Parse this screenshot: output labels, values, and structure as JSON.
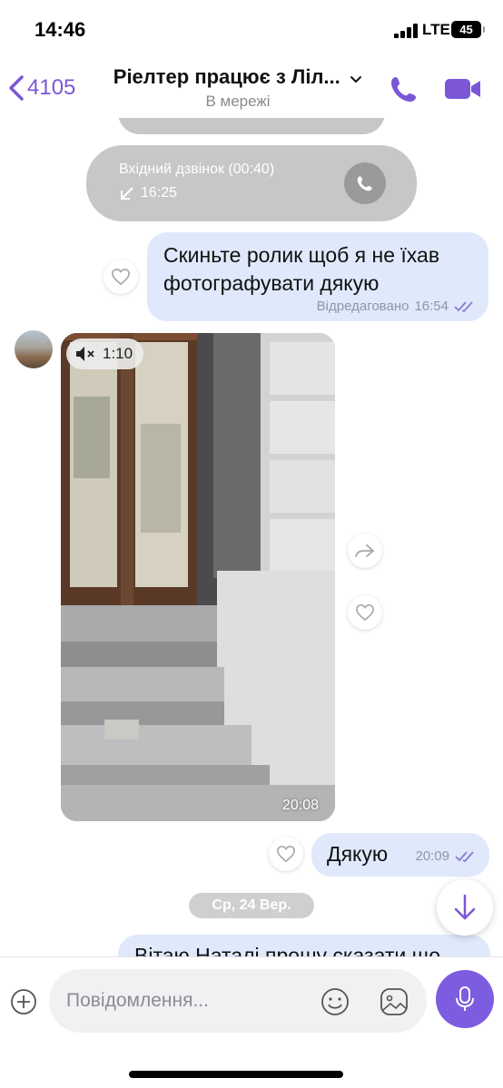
{
  "status_bar": {
    "time": "14:46",
    "network": "LTE",
    "battery": "45"
  },
  "header": {
    "back_count": "4105",
    "title": "Ріелтер працює з Ліл...",
    "status": "В мережі"
  },
  "messages": {
    "incoming_call": {
      "title": "Вхідний дзвінок (00:40)",
      "time": "16:25"
    },
    "outgoing_1": {
      "text_line1": "Скиньте ролик щоб я не їхав",
      "text_line2": "фотографувати дякую",
      "edited": "Відредаговано",
      "time": "16:54"
    },
    "video": {
      "duration": "1:10",
      "time": "20:08"
    },
    "outgoing_2": {
      "text": "Дякую",
      "time": "20:09"
    },
    "date_separator": "Ср, 24 Вер.",
    "outgoing_3": {
      "text": "Вітаю Наталі прошу сказати що"
    }
  },
  "input": {
    "placeholder": "Повідомлення..."
  },
  "colors": {
    "accent": "#7b57d8",
    "outgoing_bubble": "#dfe9fb",
    "call_bubble": "#c7c7c9"
  }
}
